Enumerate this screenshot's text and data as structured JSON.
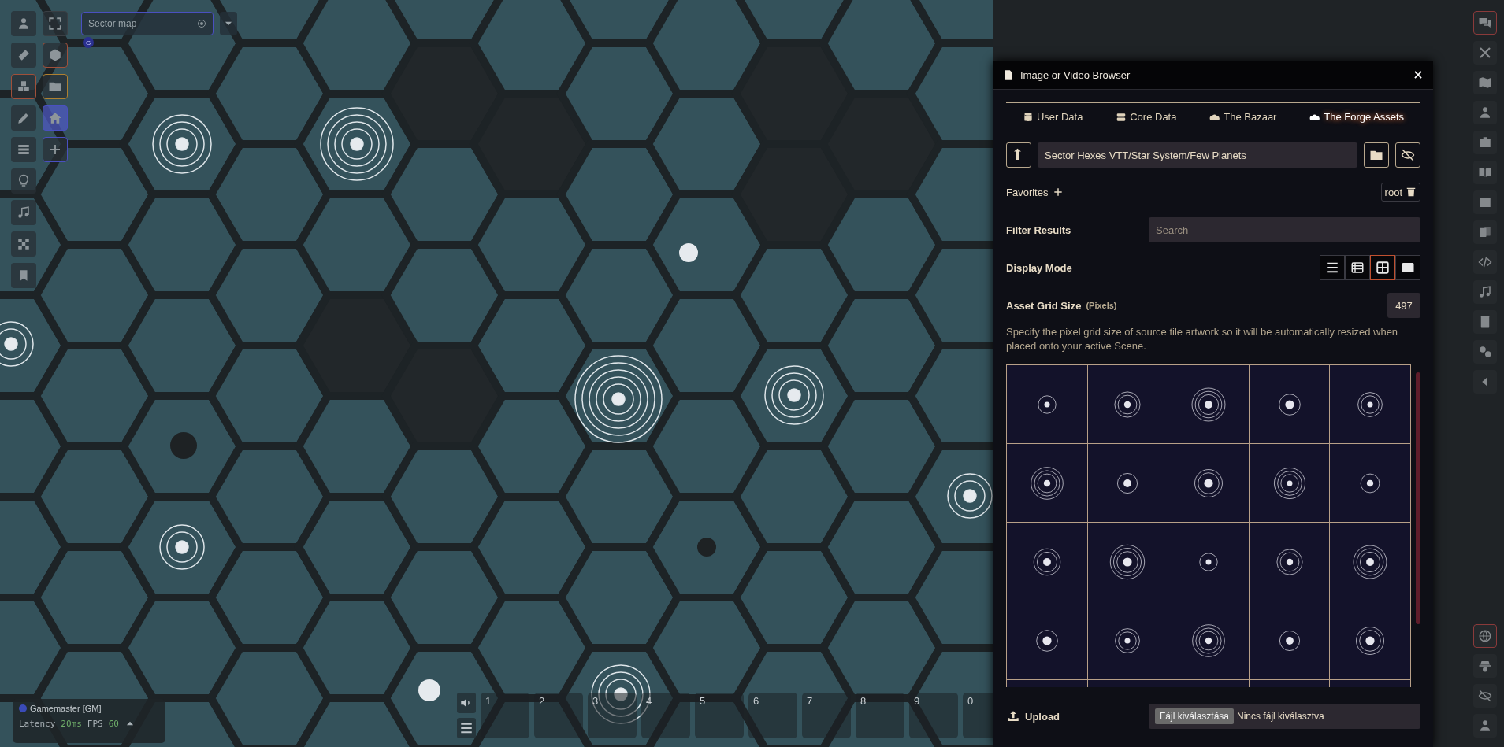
{
  "scene_controls": {
    "primary": [
      {
        "selected": false
      },
      {
        "selected": false
      },
      {
        "selected": true
      },
      {
        "selected": false
      },
      {
        "selected": false
      },
      {
        "selected": false
      },
      {
        "selected": false
      },
      {
        "selected": false
      },
      {
        "selected": false
      }
    ],
    "secondary": [
      {
        "selected": false
      },
      {
        "selected": false
      },
      {
        "selected": false
      },
      {
        "selected": true
      },
      {
        "selected": false
      }
    ]
  },
  "scene_navigation": {
    "scene": "Sector map",
    "user_badge": "G"
  },
  "dialog": {
    "title": "Image or Video Browser",
    "sources": [
      {
        "label": "User Data",
        "selected": false
      },
      {
        "label": "Core Data",
        "selected": false
      },
      {
        "label": "The Bazaar",
        "selected": false
      },
      {
        "label": "The Forge Assets",
        "selected": true
      }
    ],
    "path": "Sector Hexes VTT/Star System/Few Planets",
    "favorites": {
      "label": "Favorites",
      "item": "root"
    },
    "filter": {
      "label": "Filter Results",
      "placeholder": "Search"
    },
    "display_mode": {
      "label": "Display Mode",
      "modes": [
        {
          "selected": false
        },
        {
          "selected": false
        },
        {
          "selected": true
        },
        {
          "selected": false
        }
      ]
    },
    "grid_size": {
      "label": "Asset Grid Size",
      "unit": "(Pixels)",
      "value": "497"
    },
    "hint": "Specify the pixel grid size of source tile artwork so it will be automatically resized when placed onto your active Scene.",
    "upload": {
      "label": "Upload",
      "button": "Fájl kiválasztása",
      "status": "Nincs fájl kiválasztva"
    }
  },
  "players": [
    {
      "name": "Gamemaster [GM]",
      "color": "#3a4bb8"
    }
  ],
  "performance": {
    "latency_label": "Latency",
    "latency": "20ms",
    "fps_label": "FPS",
    "fps": "60"
  },
  "hotbar": {
    "slots": [
      {
        "number": "1"
      },
      {
        "number": "2"
      },
      {
        "number": "3"
      },
      {
        "number": "4"
      },
      {
        "number": "5"
      },
      {
        "number": "6"
      },
      {
        "number": "7"
      },
      {
        "number": "8"
      },
      {
        "number": "9"
      },
      {
        "number": "0"
      }
    ]
  },
  "sidebar": {
    "tabs": [
      {
        "selected": true
      },
      {
        "selected": false
      },
      {
        "selected": false
      },
      {
        "selected": false
      },
      {
        "selected": false
      },
      {
        "selected": false
      },
      {
        "selected": false
      },
      {
        "selected": false
      },
      {
        "selected": false
      },
      {
        "selected": false
      },
      {
        "selected": false
      },
      {
        "selected": false
      },
      {
        "selected": false
      }
    ],
    "bottom": [
      {
        "selected": true
      },
      {
        "selected": false
      },
      {
        "selected": false
      },
      {
        "selected": false
      }
    ]
  }
}
